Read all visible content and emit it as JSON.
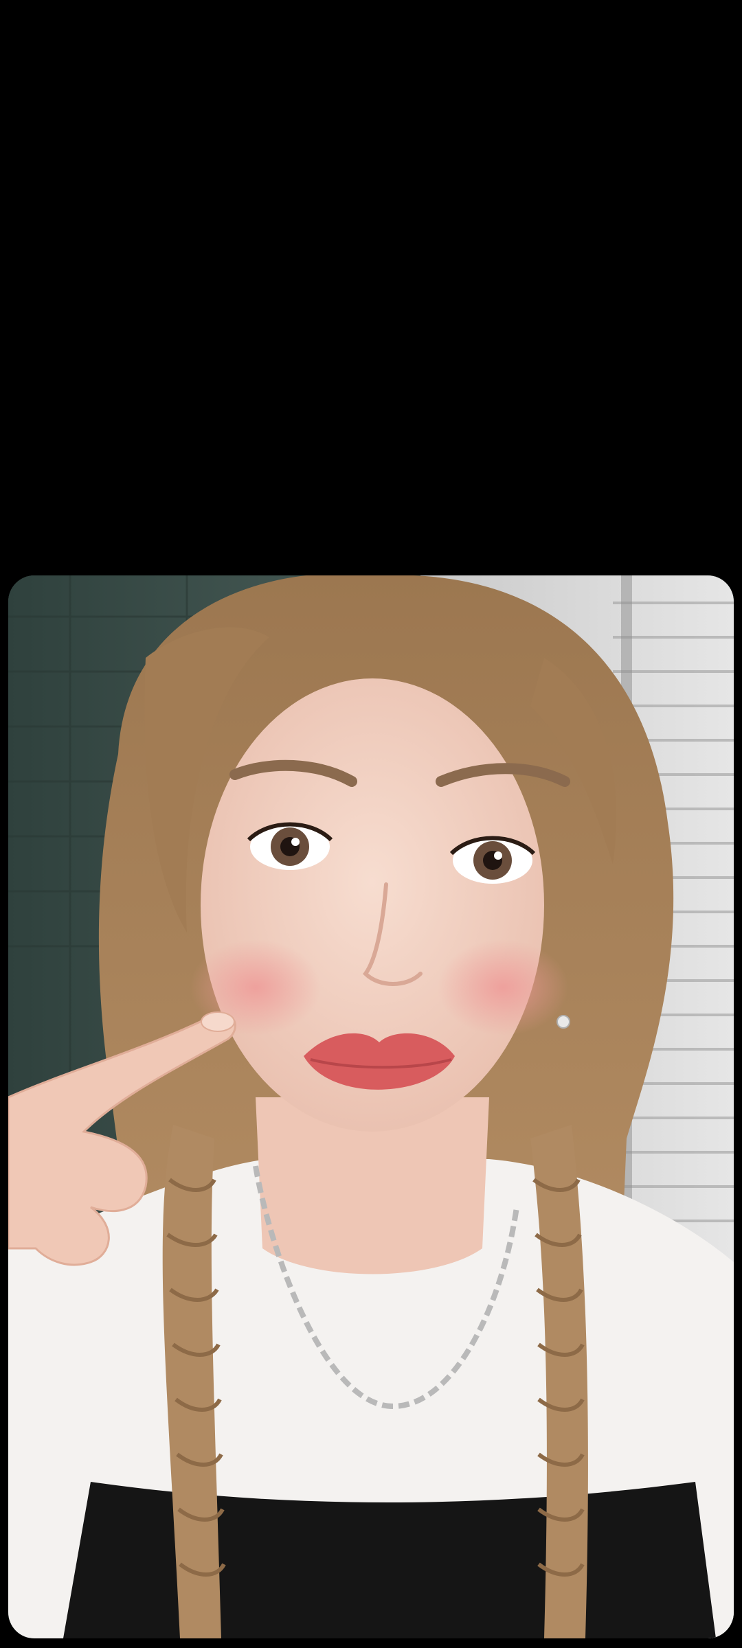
{
  "viewer": {
    "background_color": "#000000",
    "content_type": "photo",
    "photo": {
      "subject": "selfie portrait",
      "palette": {
        "blinds_left": "#3c4f4a",
        "blinds_right": "#d9d9d9",
        "hair": "#a9835c",
        "skin": "#f3d2c3",
        "blush": "#f0a9a4",
        "lips": "#d85c5e",
        "shirt": "#f4f2f0",
        "top_dark": "#151515",
        "necklace": "#b9b9b9"
      }
    }
  }
}
